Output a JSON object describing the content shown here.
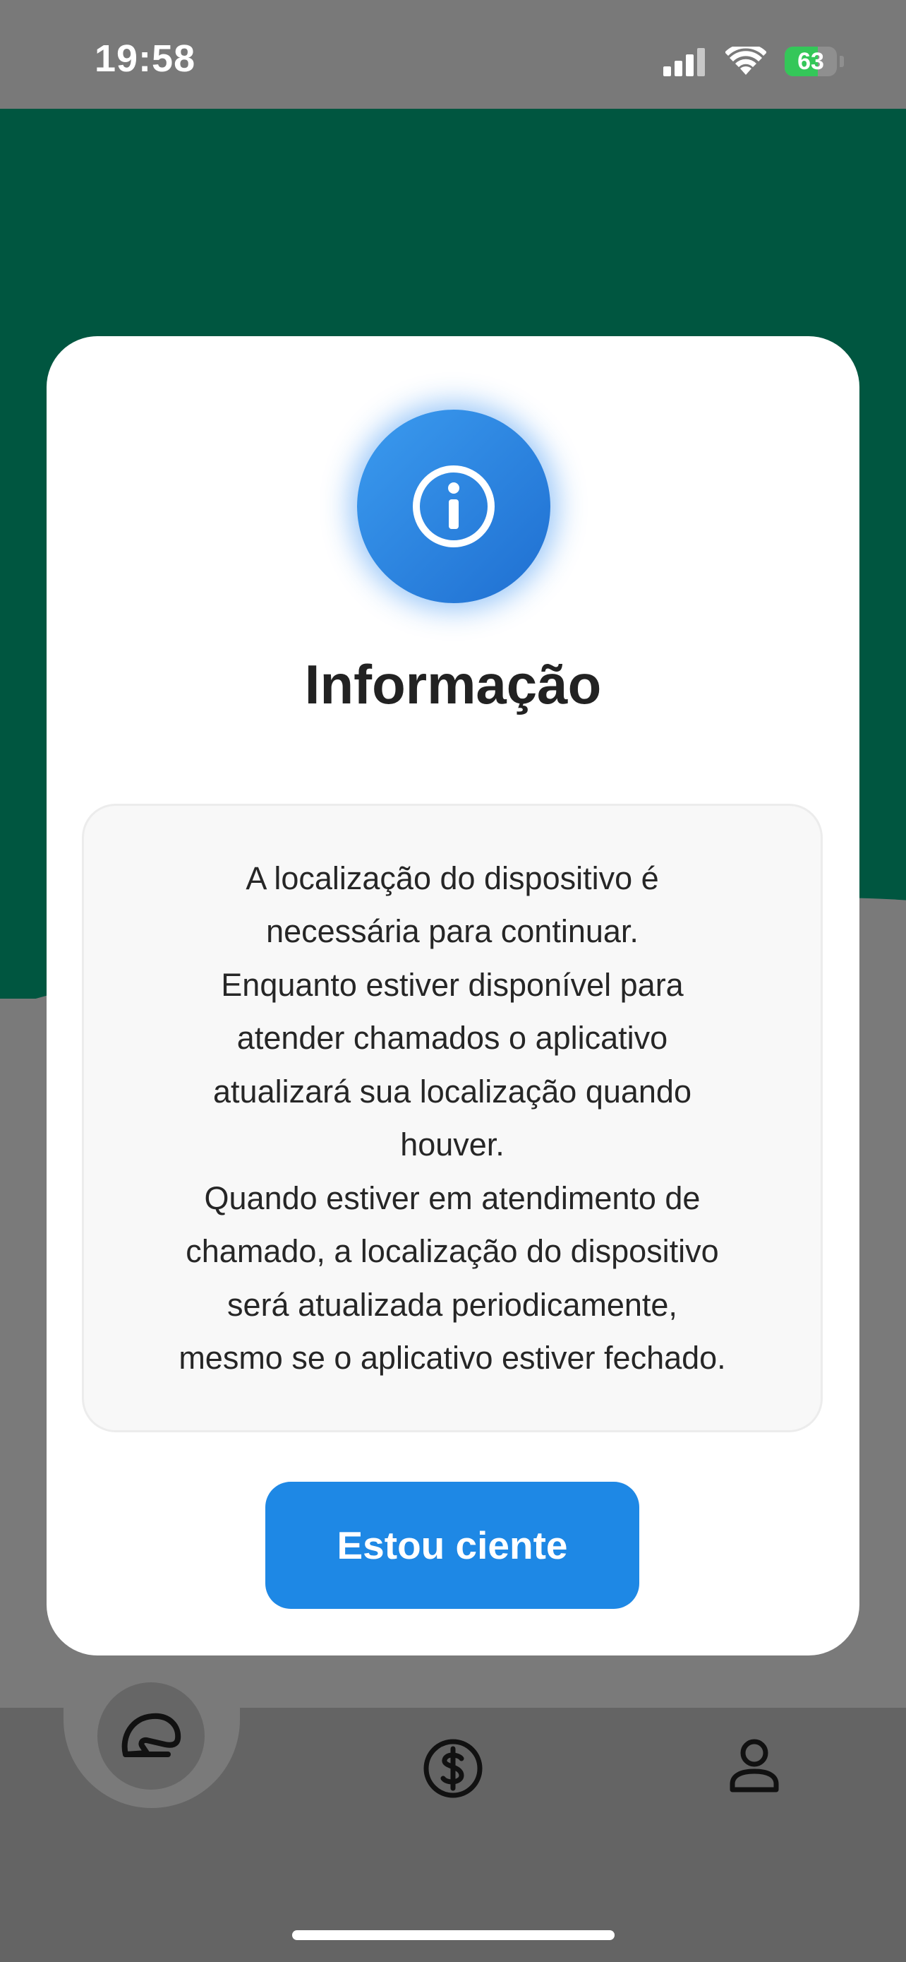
{
  "status_bar": {
    "time": "19:58",
    "battery": "63",
    "icons": [
      "signal-icon",
      "wifi-icon",
      "battery-charging-icon"
    ]
  },
  "modal": {
    "icon": "info-icon",
    "title": "Informação",
    "message": "A localização do dispositivo é\nnecessária para continuar.\nEnquanto estiver disponível para\natender chamados o aplicativo\natualizará sua localização quando\nhouver.\nQuando estiver em atendimento de\nchamado, a localização do dispositivo\nserá atualizada periodicamente,\nmesmo se o aplicativo estiver fechado.",
    "confirm_label": "Estou ciente"
  },
  "bottom_nav": {
    "items": [
      {
        "icon": "helmet-icon",
        "active": true
      },
      {
        "icon": "dollar-icon",
        "active": false
      },
      {
        "icon": "user-icon",
        "active": false
      }
    ]
  },
  "colors": {
    "green_header": "#005640",
    "primary_blue": "#1e88e5",
    "battery_green": "#34c759"
  }
}
